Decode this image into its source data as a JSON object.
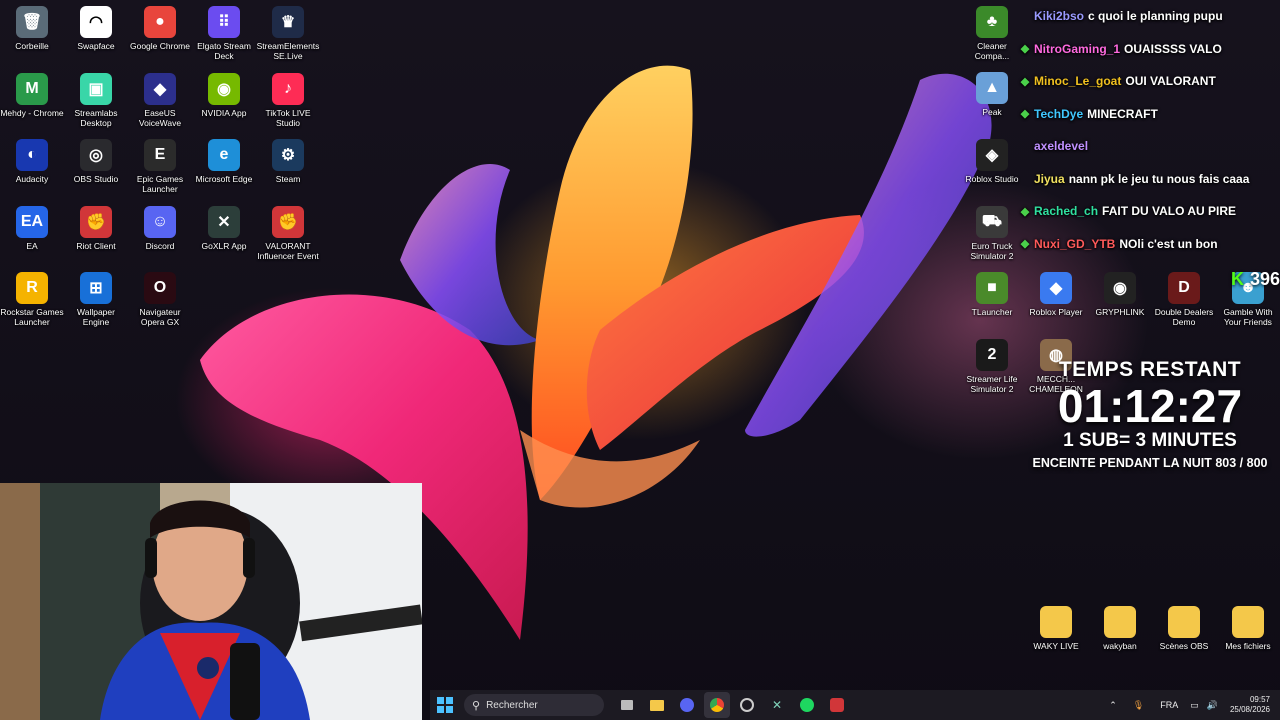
{
  "desktop_icons": [
    {
      "label": "Corbeille",
      "color": "#5a6b78",
      "glyph": "🗑"
    },
    {
      "label": "Swapface",
      "color": "#ffffff",
      "glyph": "◠"
    },
    {
      "label": "Google Chrome",
      "color": "#e8453c",
      "glyph": "●"
    },
    {
      "label": "Elgato Stream Deck",
      "color": "#6b4cf0",
      "glyph": "⠿"
    },
    {
      "label": "StreamElements SE.Live",
      "color": "#1f2b48",
      "glyph": "♛"
    },
    {
      "label": "Mehdy - Chrome",
      "color": "#2a9a4a",
      "glyph": "M"
    },
    {
      "label": "Streamlabs Desktop",
      "color": "#39d6a8",
      "glyph": "▣"
    },
    {
      "label": "EaseUS VoiceWave",
      "color": "#2c2f8c",
      "glyph": "◆"
    },
    {
      "label": "NVIDIA App",
      "color": "#76b900",
      "glyph": "◉"
    },
    {
      "label": "TikTok LIVE Studio",
      "color": "#fe2c55",
      "glyph": "♪"
    },
    {
      "label": "Audacity",
      "color": "#1838b0",
      "glyph": "◐"
    },
    {
      "label": "OBS Studio",
      "color": "#2a2a2e",
      "glyph": "◎"
    },
    {
      "label": "Epic Games Launcher",
      "color": "#2b2b2b",
      "glyph": "E"
    },
    {
      "label": "Microsoft Edge",
      "color": "#1e8fd8",
      "glyph": "e"
    },
    {
      "label": "Steam",
      "color": "#1b3a5e",
      "glyph": "⚙"
    },
    {
      "label": "EA",
      "color": "#2566e8",
      "glyph": "EA"
    },
    {
      "label": "Riot Client",
      "color": "#d13639",
      "glyph": "✊"
    },
    {
      "label": "Discord",
      "color": "#5865f2",
      "glyph": "☺"
    },
    {
      "label": "GoXLR App",
      "color": "#2c3e3a",
      "glyph": "✕"
    },
    {
      "label": "VALORANT Influencer Event",
      "color": "#d13639",
      "glyph": "✊"
    },
    {
      "label": "Rockstar Games Launcher",
      "color": "#f5b300",
      "glyph": "R"
    },
    {
      "label": "Wallpaper Engine",
      "color": "#1870d8",
      "glyph": "⊞"
    },
    {
      "label": "Navigateur Opera GX",
      "color": "#2a0a12",
      "glyph": "O"
    }
  ],
  "right_icons": [
    {
      "label": "Cleaner Compa...",
      "color": "#3b8a2a",
      "glyph": "♣"
    },
    {
      "label": "Peak",
      "color": "#6aa0d8",
      "glyph": "▲"
    },
    {
      "label": "Roblox Studio",
      "color": "#222222",
      "glyph": "◈"
    },
    {
      "label": "Euro Truck Simulator 2",
      "color": "#3a3a3a",
      "glyph": "⛟"
    },
    {
      "label": "TLauncher",
      "color": "#4a8a2a",
      "glyph": "■"
    },
    {
      "label": "Roblox Player",
      "color": "#3a7af0",
      "glyph": "◆"
    },
    {
      "label": "GRYPHLINK",
      "color": "#222222",
      "glyph": "◉"
    },
    {
      "label": "Double Dealers Demo",
      "color": "#6a1a1a",
      "glyph": "D"
    },
    {
      "label": "Gamble With Your Friends",
      "color": "#3aa0d0",
      "glyph": "☻"
    },
    {
      "label": "Streamer Life Simulator 2",
      "color": "#1a1a1a",
      "glyph": "2"
    },
    {
      "label": "MECCH... CHAMELEON",
      "color": "#8a6a4a",
      "glyph": "◍"
    }
  ],
  "folders": [
    {
      "label": "WAKY LIVE"
    },
    {
      "label": "wakyban"
    },
    {
      "label": "Scènes OBS"
    },
    {
      "label": "Mes fichiers"
    }
  ],
  "chat": [
    {
      "user": "Kiki2bso",
      "text": "c quoi le planning pupu",
      "color": "#9a9aff",
      "badge": false
    },
    {
      "user": "NitroGaming_1",
      "text": "OUAISSSS VALO",
      "color": "#ff6ae0",
      "badge": true
    },
    {
      "user": "Minoc_Le_goat",
      "text": "OUI VALORANT",
      "color": "#f0c020",
      "badge": true
    },
    {
      "user": "TechDye",
      "text": "MINECRAFT",
      "color": "#40c8ff",
      "badge": true
    },
    {
      "user": "axeldevel",
      "text": "",
      "color": "#c090ff",
      "badge": false
    },
    {
      "user": "Jiyua",
      "text": "nann pk le jeu tu nous fais caaa",
      "color": "#f0e060",
      "badge": false
    },
    {
      "user": "Rached_ch",
      "text": "FAIT DU VALO AU PIRE",
      "color": "#30e0a0",
      "badge": true
    },
    {
      "user": "Nuxi_GD_YTB",
      "text": "NOli c'est un bon",
      "color": "#ff5a5a",
      "badge": true
    }
  ],
  "viewer_badge": "396",
  "timer": {
    "title": "TEMPS RESTANT",
    "time": "01:12:27",
    "rule": "1 SUB= 3 MINUTES",
    "goal": "ENCEINTE PENDANT LA NUIT 803 / 800"
  },
  "taskbar": {
    "search_placeholder": "Rechercher",
    "language": "FRA",
    "time": "09:57",
    "date": "25/08/2026"
  }
}
